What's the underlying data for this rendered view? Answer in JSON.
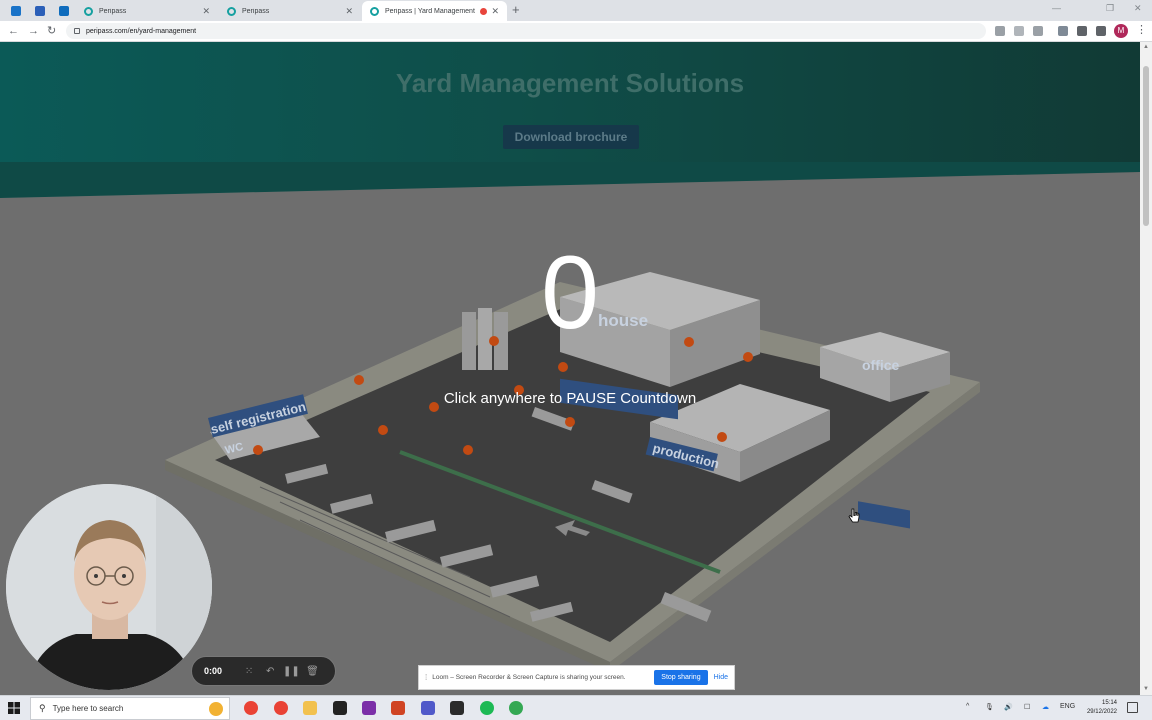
{
  "browser": {
    "tabs": [
      {
        "title": "Peripass"
      },
      {
        "title": "Peripass"
      },
      {
        "title": "Peripass | Yard Management"
      }
    ],
    "url": "peripass.com/en/yard-management",
    "profile_initial": "M"
  },
  "page": {
    "hero_title": "Yard Management Solutions",
    "download_button": "Download brochure",
    "countdown_number": "0",
    "pause_message": "Click anywhere to PAUSE Countdown",
    "map_labels": {
      "warehouse": "house",
      "office": "office",
      "self_registration": "self registration",
      "wc": "WC",
      "production": "production"
    }
  },
  "loom": {
    "timer": "0:00",
    "share_message": "Loom – Screen Recorder & Screen Capture is sharing your screen.",
    "stop_sharing": "Stop sharing",
    "hide": "Hide"
  },
  "taskbar": {
    "search_placeholder": "Type here to search",
    "language": "ENG",
    "time": "15:14",
    "date": "29/12/2022"
  },
  "colors": {
    "hero_teal": "#0b5a57",
    "countdown_text": "#ffffff",
    "loom_blue": "#1a73e8",
    "marker_orange": "#c24a12"
  }
}
